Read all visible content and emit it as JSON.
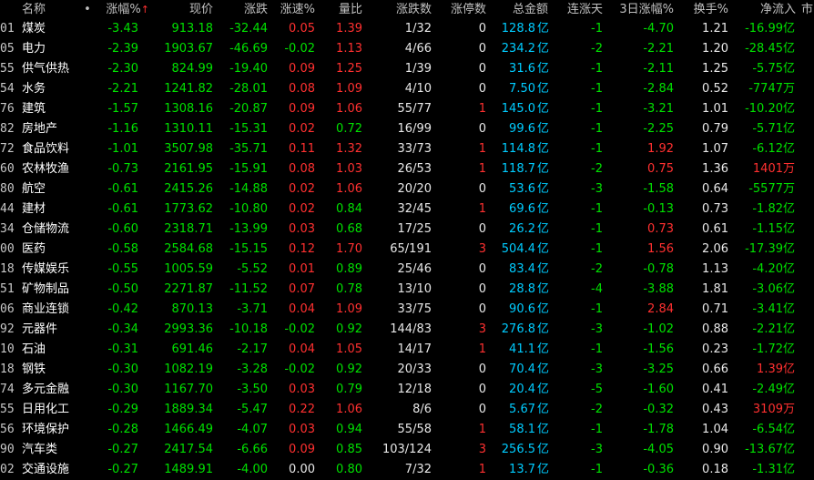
{
  "columns": {
    "name": "名称",
    "dot": "•",
    "change_pct": "涨幅%",
    "sort_arrow": "↑",
    "price": "现价",
    "change": "涨跌",
    "speed": "涨速%",
    "vol_ratio": "量比",
    "up_down": "涨跌数",
    "limit_up": "涨停数",
    "amount": "总金额",
    "streak": "连涨天",
    "change3d": "3日涨幅%",
    "turnover": "换手%",
    "net_inflow": "净流入",
    "extra": "市"
  },
  "colors": {
    "up": "#ff3030",
    "down": "#00e000",
    "amount": "#00ccff",
    "background": "#000000"
  },
  "rows": [
    {
      "code": "01",
      "name": "煤炭",
      "pct": "-3.43",
      "price": "913.18",
      "chg": "-32.44",
      "speed": "0.05",
      "vr": "1.39",
      "ud": "1/32",
      "lu": "0",
      "amt": "128.8",
      "amt_unit": "亿",
      "streak": "-1",
      "c3": "-4.70",
      "to": "1.21",
      "ni": "-16.99",
      "ni_unit": "亿"
    },
    {
      "code": "05",
      "name": "电力",
      "pct": "-2.39",
      "price": "1903.67",
      "chg": "-46.69",
      "speed": "-0.02",
      "vr": "1.13",
      "ud": "4/66",
      "lu": "0",
      "amt": "234.2",
      "amt_unit": "亿",
      "streak": "-2",
      "c3": "-2.21",
      "to": "1.20",
      "ni": "-28.45",
      "ni_unit": "亿"
    },
    {
      "code": "55",
      "name": "供气供热",
      "pct": "-2.30",
      "price": "824.99",
      "chg": "-19.40",
      "speed": "0.09",
      "vr": "1.25",
      "ud": "1/39",
      "lu": "0",
      "amt": "31.6",
      "amt_unit": "亿",
      "streak": "-1",
      "c3": "-2.11",
      "to": "1.25",
      "ni": "-5.75",
      "ni_unit": "亿"
    },
    {
      "code": "54",
      "name": "水务",
      "pct": "-2.21",
      "price": "1241.82",
      "chg": "-28.01",
      "speed": "0.08",
      "vr": "1.09",
      "ud": "4/10",
      "lu": "0",
      "amt": "7.50",
      "amt_unit": "亿",
      "streak": "-1",
      "c3": "-2.84",
      "to": "0.52",
      "ni": "-7747",
      "ni_unit": "万"
    },
    {
      "code": "76",
      "name": "建筑",
      "pct": "-1.57",
      "price": "1308.16",
      "chg": "-20.87",
      "speed": "0.09",
      "vr": "1.06",
      "ud": "55/77",
      "lu": "1",
      "amt": "145.0",
      "amt_unit": "亿",
      "streak": "-1",
      "c3": "-3.21",
      "to": "1.01",
      "ni": "-10.20",
      "ni_unit": "亿"
    },
    {
      "code": "82",
      "name": "房地产",
      "pct": "-1.16",
      "price": "1310.11",
      "chg": "-15.31",
      "speed": "0.02",
      "vr": "0.72",
      "ud": "16/99",
      "lu": "0",
      "amt": "99.6",
      "amt_unit": "亿",
      "streak": "-1",
      "c3": "-2.25",
      "to": "0.79",
      "ni": "-5.71",
      "ni_unit": "亿"
    },
    {
      "code": "72",
      "name": "食品饮料",
      "pct": "-1.01",
      "price": "3507.98",
      "chg": "-35.71",
      "speed": "0.11",
      "vr": "1.32",
      "ud": "33/73",
      "lu": "1",
      "amt": "114.8",
      "amt_unit": "亿",
      "streak": "-1",
      "c3": "1.92",
      "to": "1.07",
      "ni": "-6.12",
      "ni_unit": "亿"
    },
    {
      "code": "60",
      "name": "农林牧渔",
      "pct": "-0.73",
      "price": "2161.95",
      "chg": "-15.91",
      "speed": "0.08",
      "vr": "1.03",
      "ud": "26/53",
      "lu": "1",
      "amt": "118.7",
      "amt_unit": "亿",
      "streak": "-2",
      "c3": "0.75",
      "to": "1.36",
      "ni": "1401",
      "ni_unit": "万"
    },
    {
      "code": "80",
      "name": "航空",
      "pct": "-0.61",
      "price": "2415.26",
      "chg": "-14.88",
      "speed": "0.02",
      "vr": "1.06",
      "ud": "20/20",
      "lu": "0",
      "amt": "53.6",
      "amt_unit": "亿",
      "streak": "-3",
      "c3": "-1.58",
      "to": "0.64",
      "ni": "-5577",
      "ni_unit": "万"
    },
    {
      "code": "44",
      "name": "建材",
      "pct": "-0.61",
      "price": "1773.62",
      "chg": "-10.80",
      "speed": "0.02",
      "vr": "0.84",
      "ud": "32/45",
      "lu": "1",
      "amt": "69.6",
      "amt_unit": "亿",
      "streak": "-1",
      "c3": "-0.13",
      "to": "0.73",
      "ni": "-1.82",
      "ni_unit": "亿"
    },
    {
      "code": "34",
      "name": "仓储物流",
      "pct": "-0.60",
      "price": "2318.71",
      "chg": "-13.99",
      "speed": "0.03",
      "vr": "0.68",
      "ud": "17/25",
      "lu": "0",
      "amt": "26.2",
      "amt_unit": "亿",
      "streak": "-1",
      "c3": "0.73",
      "to": "0.61",
      "ni": "-1.15",
      "ni_unit": "亿"
    },
    {
      "code": "00",
      "name": "医药",
      "pct": "-0.58",
      "price": "2584.68",
      "chg": "-15.15",
      "speed": "0.12",
      "vr": "1.70",
      "ud": "65/191",
      "lu": "3",
      "amt": "504.4",
      "amt_unit": "亿",
      "streak": "-1",
      "c3": "1.56",
      "to": "2.06",
      "ni": "-17.39",
      "ni_unit": "亿"
    },
    {
      "code": "18",
      "name": "传媒娱乐",
      "pct": "-0.55",
      "price": "1005.59",
      "chg": "-5.52",
      "speed": "0.01",
      "vr": "0.89",
      "ud": "25/46",
      "lu": "0",
      "amt": "83.4",
      "amt_unit": "亿",
      "streak": "-2",
      "c3": "-0.78",
      "to": "1.13",
      "ni": "-4.20",
      "ni_unit": "亿"
    },
    {
      "code": "51",
      "name": "矿物制品",
      "pct": "-0.50",
      "price": "2271.87",
      "chg": "-11.52",
      "speed": "0.07",
      "vr": "0.78",
      "ud": "13/10",
      "lu": "0",
      "amt": "28.8",
      "amt_unit": "亿",
      "streak": "-4",
      "c3": "-3.88",
      "to": "1.81",
      "ni": "-3.06",
      "ni_unit": "亿"
    },
    {
      "code": "06",
      "name": "商业连锁",
      "pct": "-0.42",
      "price": "870.13",
      "chg": "-3.71",
      "speed": "0.04",
      "vr": "1.09",
      "ud": "33/75",
      "lu": "0",
      "amt": "90.6",
      "amt_unit": "亿",
      "streak": "-1",
      "c3": "2.84",
      "to": "0.71",
      "ni": "-3.41",
      "ni_unit": "亿"
    },
    {
      "code": "92",
      "name": "元器件",
      "pct": "-0.34",
      "price": "2993.36",
      "chg": "-10.18",
      "speed": "-0.02",
      "vr": "0.92",
      "ud": "144/83",
      "lu": "3",
      "amt": "276.8",
      "amt_unit": "亿",
      "streak": "-3",
      "c3": "-1.02",
      "to": "0.88",
      "ni": "-2.21",
      "ni_unit": "亿"
    },
    {
      "code": "10",
      "name": "石油",
      "pct": "-0.31",
      "price": "691.46",
      "chg": "-2.17",
      "speed": "0.04",
      "vr": "1.05",
      "ud": "14/17",
      "lu": "1",
      "amt": "41.1",
      "amt_unit": "亿",
      "streak": "-1",
      "c3": "-1.56",
      "to": "0.23",
      "ni": "-1.72",
      "ni_unit": "亿"
    },
    {
      "code": "18",
      "name": "钢铁",
      "pct": "-0.30",
      "price": "1082.19",
      "chg": "-3.28",
      "speed": "-0.02",
      "vr": "0.92",
      "ud": "20/33",
      "lu": "0",
      "amt": "70.4",
      "amt_unit": "亿",
      "streak": "-3",
      "c3": "-3.25",
      "to": "0.66",
      "ni": "1.39",
      "ni_unit": "亿"
    },
    {
      "code": "74",
      "name": "多元金融",
      "pct": "-0.30",
      "price": "1167.70",
      "chg": "-3.50",
      "speed": "0.03",
      "vr": "0.79",
      "ud": "12/18",
      "lu": "0",
      "amt": "20.4",
      "amt_unit": "亿",
      "streak": "-5",
      "c3": "-1.60",
      "to": "0.41",
      "ni": "-2.49",
      "ni_unit": "亿"
    },
    {
      "code": "55",
      "name": "日用化工",
      "pct": "-0.29",
      "price": "1889.34",
      "chg": "-5.47",
      "speed": "0.22",
      "vr": "1.06",
      "ud": "8/6",
      "lu": "0",
      "amt": "5.67",
      "amt_unit": "亿",
      "streak": "-2",
      "c3": "-0.32",
      "to": "0.43",
      "ni": "3109",
      "ni_unit": "万"
    },
    {
      "code": "56",
      "name": "环境保护",
      "pct": "-0.28",
      "price": "1466.49",
      "chg": "-4.07",
      "speed": "0.03",
      "vr": "0.94",
      "ud": "55/58",
      "lu": "1",
      "amt": "58.1",
      "amt_unit": "亿",
      "streak": "-1",
      "c3": "-1.78",
      "to": "1.04",
      "ni": "-6.54",
      "ni_unit": "亿"
    },
    {
      "code": "90",
      "name": "汽车类",
      "pct": "-0.27",
      "price": "2417.54",
      "chg": "-6.66",
      "speed": "0.09",
      "vr": "0.85",
      "ud": "103/124",
      "lu": "3",
      "amt": "256.5",
      "amt_unit": "亿",
      "streak": "-3",
      "c3": "-4.05",
      "to": "0.90",
      "ni": "-13.67",
      "ni_unit": "亿"
    },
    {
      "code": "02",
      "name": "交通设施",
      "pct": "-0.27",
      "price": "1489.91",
      "chg": "-4.00",
      "speed": "0.00",
      "vr": "0.80",
      "ud": "7/32",
      "lu": "1",
      "amt": "13.7",
      "amt_unit": "亿",
      "streak": "-1",
      "c3": "-0.36",
      "to": "0.18",
      "ni": "-1.31",
      "ni_unit": "亿"
    }
  ]
}
